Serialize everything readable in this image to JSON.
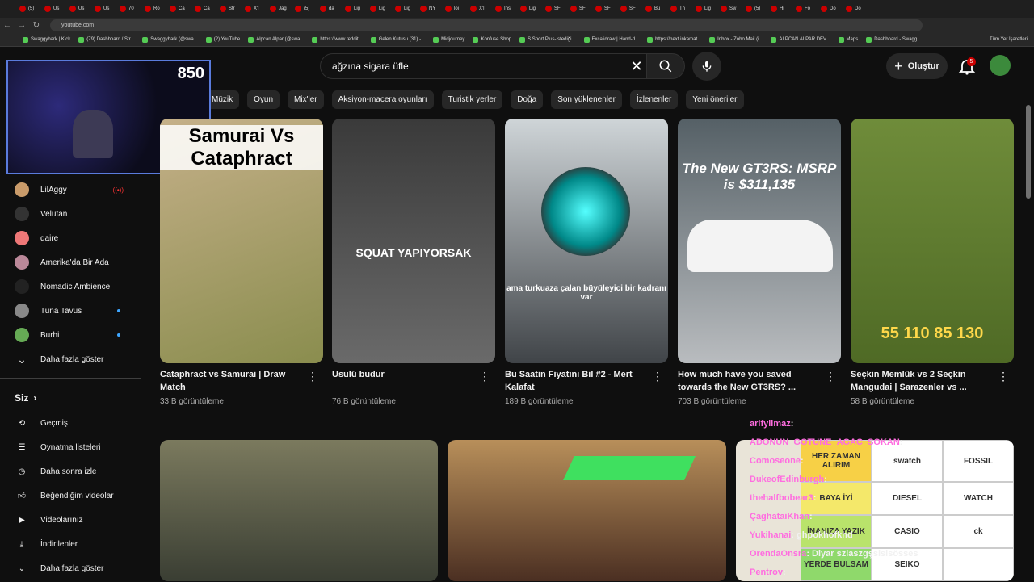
{
  "browser": {
    "tabs": [
      "(5)",
      "Us",
      "Us",
      "Us",
      "70",
      "Ro",
      "Ca",
      "Ca",
      "Str",
      "X'l",
      "Jag",
      "(5)",
      "da",
      "Lig",
      "Lig",
      "Lig",
      "NY",
      "loi",
      "X'l",
      "Ins",
      "Lig",
      "SF",
      "SF",
      "SF",
      "SF",
      "Bu",
      "Th",
      "Lig",
      "Sw",
      "(5)",
      "Hi",
      "Fo",
      "Do",
      "Do"
    ],
    "url": "youtube.com",
    "bookmarks": [
      "Swaggybark | Kick",
      "(79) Dashboard / Str...",
      "Swaggybark (@swa...",
      "(2) YouTube",
      "Alpcan Alpar (@swa...",
      "https://www.reddit...",
      "Gelen Kutusu (31) -...",
      "Midjourney",
      "Konfuse Shop",
      "S Sport Plus-İstediği...",
      "Excalidraw | Hand-d...",
      "https://next.inkamat...",
      "Inbox - Zoho Mail (i...",
      "ALPCAN ALPAR DEV...",
      "Maps",
      "Dashboard - Swagg..."
    ],
    "bookmarks_all": "Tüm Yer İşaretleri"
  },
  "header": {
    "search_query": "ağzına sigara üfle",
    "create_label": "Oluştur",
    "notif_count": "5"
  },
  "chips": [
    "Müzik",
    "Oyun",
    "Mix'ler",
    "Aksiyon-macera oyunları",
    "Turistik yerler",
    "Doğa",
    "Son yüklenenler",
    "İzlenenler",
    "Yeni öneriler"
  ],
  "webcam": {
    "viewer_count": "850"
  },
  "subscriptions": [
    {
      "name": "LilAggy",
      "state": "live"
    },
    {
      "name": "Velutan",
      "state": ""
    },
    {
      "name": "daire",
      "state": ""
    },
    {
      "name": "Amerika'da Bir Ada",
      "state": ""
    },
    {
      "name": "Nomadic Ambience",
      "state": ""
    },
    {
      "name": "Tuna Tavus",
      "state": "dot"
    },
    {
      "name": "Burhi",
      "state": "dot"
    }
  ],
  "sidebar": {
    "show_more_1": "Daha fazla göster",
    "you_heading": "Siz",
    "you_items": [
      "Geçmiş",
      "Oynatma listeleri",
      "Daha sonra izle",
      "Beğendiğim videolar",
      "Videolarınız",
      "İndirilenler",
      "Daha fazla göster"
    ]
  },
  "videos": [
    {
      "title": "Cataphract vs Samurai | Draw Match",
      "meta": "33 B görüntüleme",
      "thumb_text": "Samurai Vs Cataphract"
    },
    {
      "title": "Usulü budur",
      "meta": "76 B görüntüleme",
      "thumb_text": "SQUAT YAPIYORSAK"
    },
    {
      "title": "Bu Saatin Fiyatını Bil #2 - Mert Kalafat",
      "meta": "189 B görüntüleme",
      "thumb_text": "ama turkuaza çalan büyüleyici bir kadranı var"
    },
    {
      "title": "How much have you saved towards the New GT3RS? ...",
      "meta": "703 B görüntüleme",
      "thumb_text": "The New GT3RS: MSRP is $311,135"
    },
    {
      "title": "Seçkin Memlük vs 2 Seçkin Mangudai | Sarazenler vs ...",
      "meta": "58 B görüntüleme",
      "thumb_text": "55 110 85 130"
    }
  ],
  "tier_cells": [
    "HER ZAMAN ALIRIM",
    "swatch",
    "FOSSIL",
    "BAYA İYİ",
    "DIESEL",
    "WATCH",
    "İNANIZA YAZIK",
    "CASIO",
    "ck",
    "YERDE BULSAM",
    "SEIKO",
    ""
  ],
  "chat": [
    {
      "user": "arifyilmaz",
      "msg": ":"
    },
    {
      "user": "ADONUN_GOTUNE_AGAC_SOKAN",
      "msg": ":"
    },
    {
      "user": "Comoseone",
      "msg": ":"
    },
    {
      "user": "DukeofEdinburgh",
      "msg": ":"
    },
    {
      "user": "thehalfbobear3",
      "msg": ":"
    },
    {
      "user": "ÇaghataiKhan",
      "msg": ":"
    },
    {
      "user": "Yukihanai",
      "msg": ": ghpokhofkhd"
    },
    {
      "user": "OrendaOnsra",
      "msg": ": Diyar sziaszgşsisisösses"
    },
    {
      "user": "Pentrov",
      "msg": ":"
    }
  ]
}
